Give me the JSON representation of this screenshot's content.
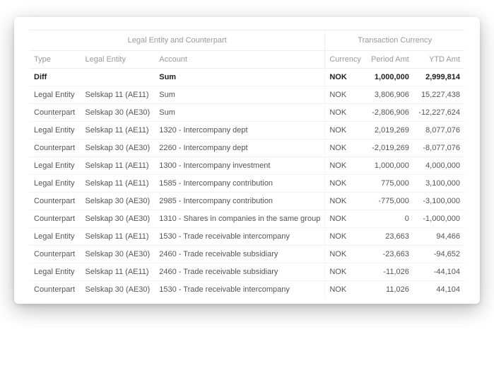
{
  "headers": {
    "group_left": "Legal Entity and Counterpart",
    "group_right": "Transaction Currency",
    "type": "Type",
    "legal_entity": "Legal Entity",
    "account": "Account",
    "currency": "Currency",
    "period_amt": "Period Amt",
    "ytd_amt": "YTD Amt"
  },
  "rows": [
    {
      "type": "Diff",
      "legal_entity": "",
      "account": "Sum",
      "currency": "NOK",
      "period_amt": "1,000,000",
      "ytd_amt": "2,999,814",
      "bold": true
    },
    {
      "type": "Legal Entity",
      "legal_entity": "Selskap 11 (AE11)",
      "account": "Sum",
      "currency": "NOK",
      "period_amt": "3,806,906",
      "ytd_amt": "15,227,438",
      "bold": false
    },
    {
      "type": "Counterpart",
      "legal_entity": "Selskap 30 (AE30)",
      "account": "Sum",
      "currency": "NOK",
      "period_amt": "-2,806,906",
      "ytd_amt": "-12,227,624",
      "bold": false
    },
    {
      "type": "Legal Entity",
      "legal_entity": "Selskap 11 (AE11)",
      "account": "1320 - Intercompany dept",
      "currency": "NOK",
      "period_amt": "2,019,269",
      "ytd_amt": "8,077,076",
      "bold": false
    },
    {
      "type": "Counterpart",
      "legal_entity": "Selskap 30 (AE30)",
      "account": "2260 - Intercompany dept",
      "currency": "NOK",
      "period_amt": "-2,019,269",
      "ytd_amt": "-8,077,076",
      "bold": false
    },
    {
      "type": "Legal Entity",
      "legal_entity": "Selskap 11 (AE11)",
      "account": "1300 - Intercompany investment",
      "currency": "NOK",
      "period_amt": "1,000,000",
      "ytd_amt": "4,000,000",
      "bold": false
    },
    {
      "type": "Legal Entity",
      "legal_entity": "Selskap 11 (AE11)",
      "account": "1585 - Intercompany contribution",
      "currency": "NOK",
      "period_amt": "775,000",
      "ytd_amt": "3,100,000",
      "bold": false
    },
    {
      "type": "Counterpart",
      "legal_entity": "Selskap 30 (AE30)",
      "account": "2985 - Intercompany contribution",
      "currency": "NOK",
      "period_amt": "-775,000",
      "ytd_amt": "-3,100,000",
      "bold": false
    },
    {
      "type": "Counterpart",
      "legal_entity": "Selskap 30 (AE30)",
      "account": "1310 - Shares in companies in the same group",
      "currency": "NOK",
      "period_amt": "0",
      "ytd_amt": "-1,000,000",
      "bold": false
    },
    {
      "type": "Legal Entity",
      "legal_entity": "Selskap 11 (AE11)",
      "account": "1530 - Trade receivable intercompany",
      "currency": "NOK",
      "period_amt": "23,663",
      "ytd_amt": "94,466",
      "bold": false
    },
    {
      "type": "Counterpart",
      "legal_entity": "Selskap 30 (AE30)",
      "account": "2460 - Trade receivable subsidiary",
      "currency": "NOK",
      "period_amt": "-23,663",
      "ytd_amt": "-94,652",
      "bold": false
    },
    {
      "type": "Legal Entity",
      "legal_entity": "Selskap 11 (AE11)",
      "account": "2460 - Trade receivable subsidiary",
      "currency": "NOK",
      "period_amt": "-11,026",
      "ytd_amt": "-44,104",
      "bold": false
    },
    {
      "type": "Counterpart",
      "legal_entity": "Selskap 30 (AE30)",
      "account": "1530 - Trade receivable intercompany",
      "currency": "NOK",
      "period_amt": "11,026",
      "ytd_amt": "44,104",
      "bold": false
    }
  ]
}
